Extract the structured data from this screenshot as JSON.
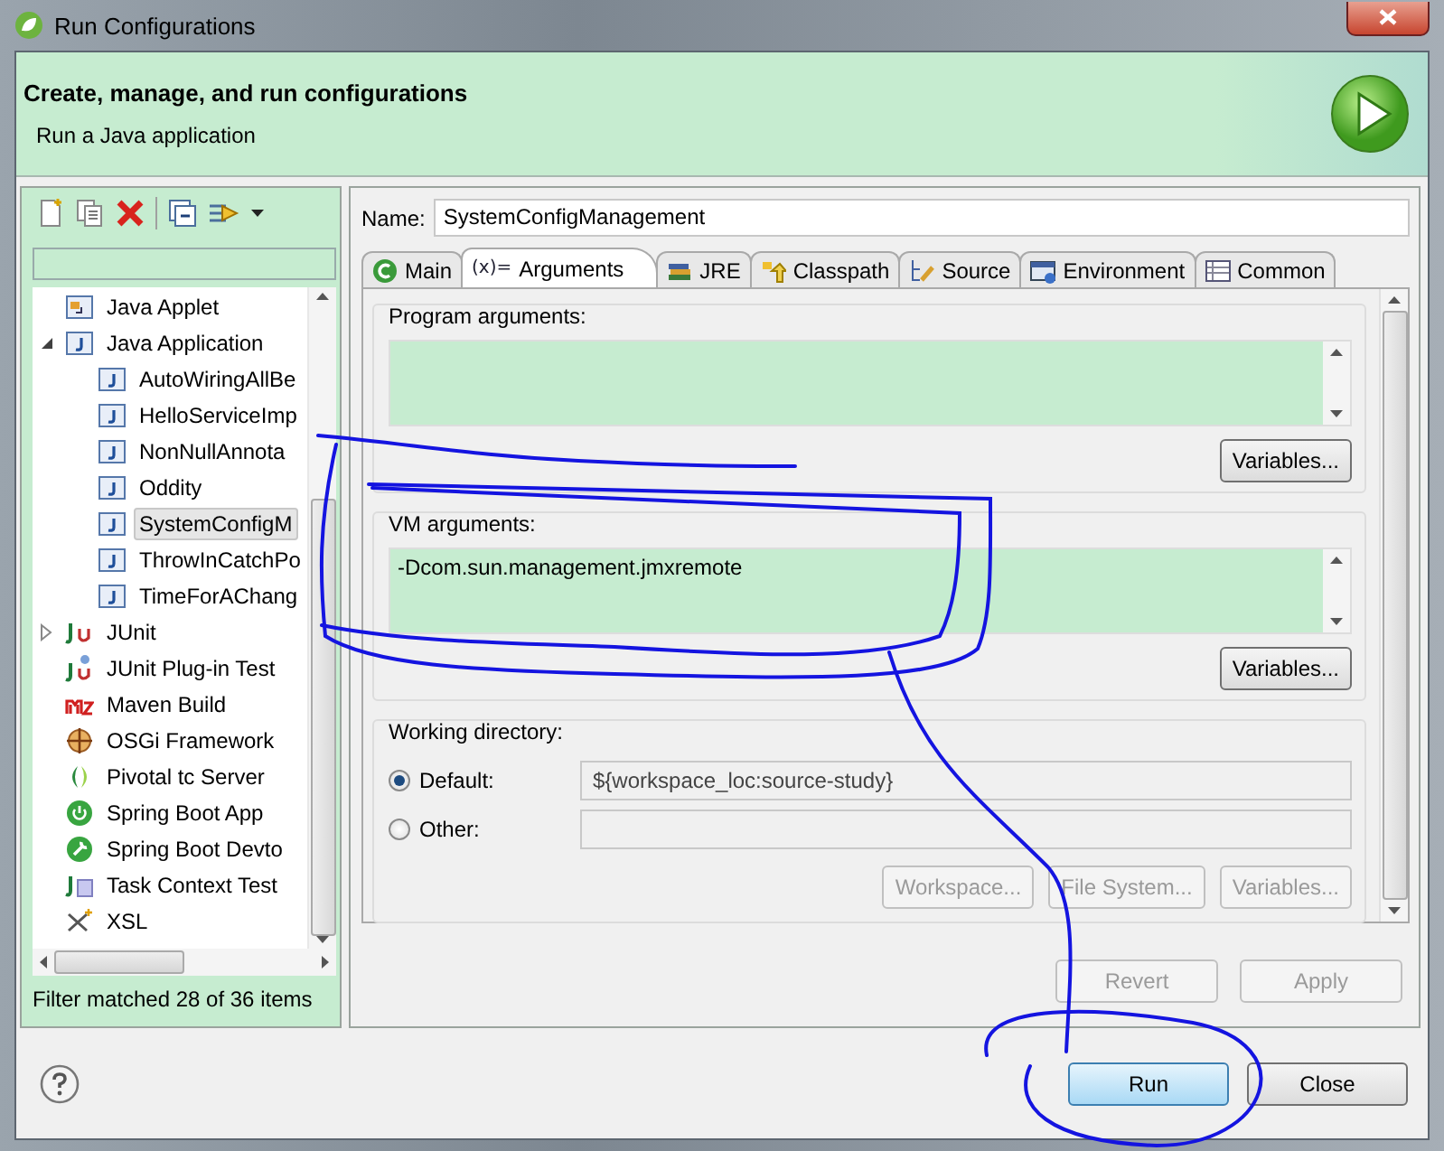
{
  "window": {
    "title": "Run Configurations"
  },
  "header": {
    "title": "Create, manage, and run configurations",
    "subtitle": "Run a Java application"
  },
  "sidebar": {
    "tree": [
      {
        "label": "Java Applet",
        "kind": "applet",
        "selected": false
      },
      {
        "label": "Java Application",
        "kind": "java",
        "selected": false,
        "expanded": true,
        "children": [
          {
            "label": "AutoWiringAllBe",
            "kind": "java",
            "selected": false
          },
          {
            "label": "HelloServiceImp",
            "kind": "java",
            "selected": false
          },
          {
            "label": "NonNullAnnota",
            "kind": "java",
            "selected": false
          },
          {
            "label": "Oddity",
            "kind": "java",
            "selected": false
          },
          {
            "label": "SystemConfigM",
            "kind": "java",
            "selected": true
          },
          {
            "label": "ThrowInCatchPo",
            "kind": "java",
            "selected": false
          },
          {
            "label": "TimeForAChang",
            "kind": "java",
            "selected": false
          }
        ]
      },
      {
        "label": "JUnit",
        "kind": "junit",
        "selected": false,
        "expanded": false
      },
      {
        "label": "JUnit Plug-in Test",
        "kind": "plugin",
        "selected": false
      },
      {
        "label": "Maven Build",
        "kind": "maven",
        "selected": false
      },
      {
        "label": "OSGi Framework",
        "kind": "osgi",
        "selected": false
      },
      {
        "label": "Pivotal tc Server",
        "kind": "pivotal",
        "selected": false
      },
      {
        "label": "Spring Boot App",
        "kind": "spring",
        "selected": false
      },
      {
        "label": "Spring Boot Devto",
        "kind": "devtools",
        "selected": false
      },
      {
        "label": "Task Context Test",
        "kind": "task",
        "selected": false
      },
      {
        "label": "XSL",
        "kind": "xsl",
        "selected": false
      }
    ],
    "status": "Filter matched 28 of 36 items"
  },
  "name": {
    "label": "Name:",
    "value": "SystemConfigManagement"
  },
  "tabs": [
    {
      "label": "Main",
      "kind": "main",
      "selected": false
    },
    {
      "label": "Arguments",
      "icon": "(x)=",
      "selected": true
    },
    {
      "label": "JRE",
      "kind": "jre",
      "selected": false
    },
    {
      "label": "Classpath",
      "kind": "classpath",
      "selected": false
    },
    {
      "label": "Source",
      "kind": "source",
      "selected": false
    },
    {
      "label": "Environment",
      "kind": "environment",
      "selected": false
    },
    {
      "label": "Common",
      "kind": "common",
      "selected": false
    }
  ],
  "program_arguments": {
    "label": "Program arguments:",
    "button": "Variables..."
  },
  "vm_arguments": {
    "label": "VM arguments:",
    "value": "-Dcom.sun.management.jmxremote",
    "button": "Variables..."
  },
  "working_directory": {
    "label": "Working directory:",
    "options": [
      {
        "label": "Default:",
        "selected": true,
        "value": "${workspace_loc:source-study}"
      },
      {
        "label": "Other:",
        "selected": false
      }
    ],
    "buttons": [
      {
        "label": "Workspace...",
        "disabled": true
      },
      {
        "label": "File System...",
        "disabled": true
      },
      {
        "label": "Variables...",
        "disabled": true
      }
    ]
  },
  "actions": [
    {
      "label": "Revert",
      "disabled": true
    },
    {
      "label": "Apply",
      "disabled": true
    }
  ],
  "dialog_buttons": [
    {
      "label": "Run",
      "focused": true
    },
    {
      "label": "Close",
      "focused": false
    }
  ]
}
